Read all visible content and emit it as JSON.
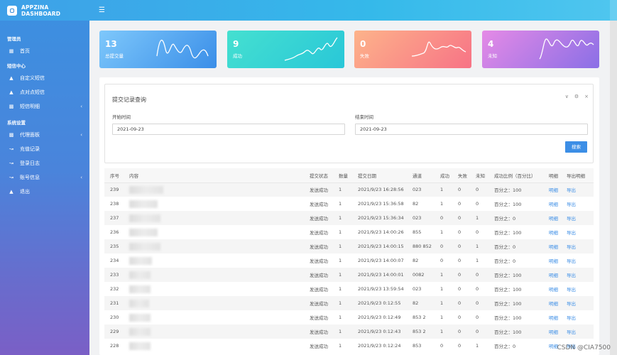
{
  "app": {
    "title": "APPZINA DASHBOARD",
    "menu_icon": "hamburger-icon"
  },
  "sidebar": {
    "sections": [
      {
        "title": "管理员",
        "items": [
          {
            "label": "首页",
            "icon": "grid-icon",
            "has_submenu": false
          }
        ]
      },
      {
        "title": "短信中心",
        "items": [
          {
            "label": "自定义短信",
            "icon": "sitemap-icon",
            "has_submenu": false
          },
          {
            "label": "点对点短信",
            "icon": "sitemap-icon",
            "has_submenu": false
          },
          {
            "label": "短信明细",
            "icon": "bar-chart-icon",
            "has_submenu": true
          }
        ]
      },
      {
        "title": "系统设置",
        "items": [
          {
            "label": "代理面板",
            "icon": "bar-chart-icon",
            "has_submenu": true
          },
          {
            "label": "充值记录",
            "icon": "line-chart-icon",
            "has_submenu": false
          },
          {
            "label": "登录日志",
            "icon": "line-chart-icon",
            "has_submenu": false
          },
          {
            "label": "账号信息",
            "icon": "line-chart-icon",
            "has_submenu": true
          },
          {
            "label": "退出",
            "icon": "sitemap-icon",
            "has_submenu": false
          }
        ]
      }
    ],
    "chevron": "‹"
  },
  "stats": [
    {
      "value": "13",
      "label": "总提交量",
      "color_from": "#7ec8fb",
      "color_to": "#3a8ee8"
    },
    {
      "value": "9",
      "label": "成功",
      "color_from": "#45e0d0",
      "color_to": "#29c7d8"
    },
    {
      "value": "0",
      "label": "失败",
      "color_from": "#fdb38a",
      "color_to": "#f77386"
    },
    {
      "value": "4",
      "label": "未知",
      "color_from": "#e58ae6",
      "color_to": "#8a6fe6"
    }
  ],
  "query": {
    "title": "提交记录查询",
    "tools": [
      "∨",
      "⚙",
      "×"
    ],
    "start_label": "开始时间",
    "start_value": "2021-09-23",
    "end_label": "结束时间",
    "end_value": "2021-09-23",
    "search_label": "搜索"
  },
  "table": {
    "headers": [
      "序号",
      "内容",
      "提交状态",
      "数量",
      "提交日期",
      "通道",
      "成功",
      "失败",
      "未知",
      "成功比例（百分比）",
      "明细",
      "导出明细"
    ],
    "rows": [
      {
        "id": "239",
        "content": "",
        "status": "发送成功",
        "qty": "1",
        "date": "2021/9/23 16:28:56",
        "channel": "023",
        "success": "1",
        "fail": "0",
        "unknown": "0",
        "ratio": "百分之：100",
        "detail": "明细",
        "export": "导出"
      },
      {
        "id": "238",
        "content": "",
        "status": "发送成功",
        "qty": "1",
        "date": "2021/9/23 15:36:58",
        "channel": "82",
        "success": "1",
        "fail": "0",
        "unknown": "0",
        "ratio": "百分之：100",
        "detail": "明细",
        "export": "导出"
      },
      {
        "id": "237",
        "content": "",
        "status": "发送成功",
        "qty": "1",
        "date": "2021/9/23 15:36:34",
        "channel": "023",
        "success": "0",
        "fail": "0",
        "unknown": "1",
        "ratio": "百分之：0",
        "detail": "明细",
        "export": "导出"
      },
      {
        "id": "236",
        "content": "",
        "status": "发送成功",
        "qty": "1",
        "date": "2021/9/23 14:00:26",
        "channel": "855",
        "success": "1",
        "fail": "0",
        "unknown": "0",
        "ratio": "百分之：100",
        "detail": "明细",
        "export": "导出"
      },
      {
        "id": "235",
        "content": "",
        "status": "发送成功",
        "qty": "1",
        "date": "2021/9/23 14:00:15",
        "channel": "880 852",
        "success": "0",
        "fail": "0",
        "unknown": "1",
        "ratio": "百分之：0",
        "detail": "明细",
        "export": "导出"
      },
      {
        "id": "234",
        "content": "",
        "status": "发送成功",
        "qty": "1",
        "date": "2021/9/23 14:00:07",
        "channel": "82",
        "success": "0",
        "fail": "0",
        "unknown": "1",
        "ratio": "百分之：0",
        "detail": "明细",
        "export": "导出"
      },
      {
        "id": "233",
        "content": "",
        "status": "发送成功",
        "qty": "1",
        "date": "2021/9/23 14:00:01",
        "channel": "0082",
        "success": "1",
        "fail": "0",
        "unknown": "0",
        "ratio": "百分之：100",
        "detail": "明细",
        "export": "导出"
      },
      {
        "id": "232",
        "content": "",
        "status": "发送成功",
        "qty": "1",
        "date": "2021/9/23 13:59:54",
        "channel": "023",
        "success": "1",
        "fail": "0",
        "unknown": "0",
        "ratio": "百分之：100",
        "detail": "明细",
        "export": "导出"
      },
      {
        "id": "231",
        "content": "",
        "status": "发送成功",
        "qty": "1",
        "date": "2021/9/23 0:12:55",
        "channel": "82",
        "success": "1",
        "fail": "0",
        "unknown": "0",
        "ratio": "百分之：100",
        "detail": "明细",
        "export": "导出"
      },
      {
        "id": "230",
        "content": "",
        "status": "发送成功",
        "qty": "1",
        "date": "2021/9/23 0:12:49",
        "channel": "853 2",
        "success": "1",
        "fail": "0",
        "unknown": "0",
        "ratio": "百分之：100",
        "detail": "明细",
        "export": "导出"
      },
      {
        "id": "229",
        "content": "",
        "status": "发送成功",
        "qty": "1",
        "date": "2021/9/23 0:12:43",
        "channel": "853 2",
        "success": "1",
        "fail": "0",
        "unknown": "0",
        "ratio": "百分之：100",
        "detail": "明细",
        "export": "导出"
      },
      {
        "id": "228",
        "content": "",
        "status": "发送成功",
        "qty": "1",
        "date": "2021/9/23 0:12:24",
        "channel": "853",
        "success": "0",
        "fail": "0",
        "unknown": "1",
        "ratio": "百分之：0",
        "detail": "明细",
        "export": "导出"
      }
    ]
  },
  "watermark": "CSDN @CIA7500"
}
